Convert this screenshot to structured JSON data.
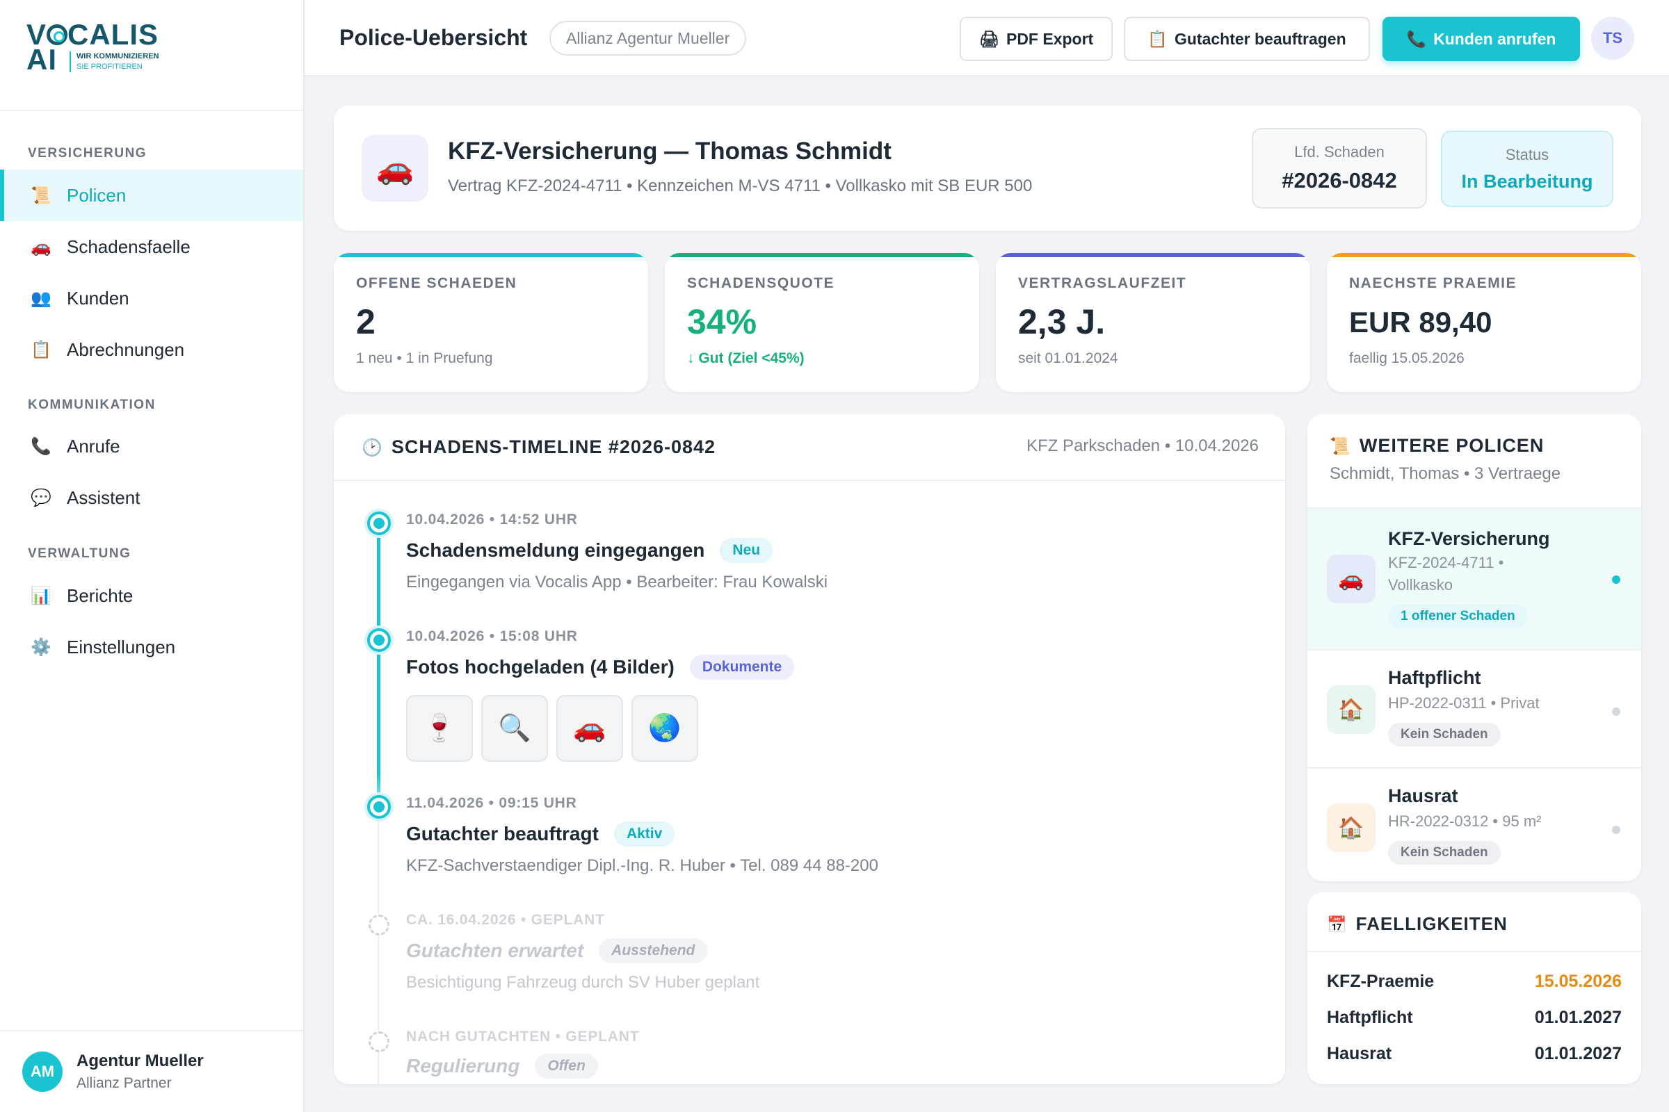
{
  "brand": {
    "logo_top": "VOCALIS",
    "logo_bottom": "AI",
    "tagline_1": "WIR KOMMUNIZIEREN",
    "tagline_2": "SIE PROFITIEREN"
  },
  "sidebar": {
    "sections": [
      "VERSICHERUNG",
      "KOMMUNIKATION",
      "VERWALTUNG"
    ],
    "items": [
      {
        "label": "Policen",
        "icon": "scroll-icon",
        "glyph": "📜",
        "active": true
      },
      {
        "label": "Schadensfaelle",
        "icon": "car-icon",
        "glyph": "🚗"
      },
      {
        "label": "Kunden",
        "icon": "users-icon",
        "glyph": "👥"
      },
      {
        "label": "Abrechnungen",
        "icon": "clipboard-icon",
        "glyph": "📋"
      },
      {
        "label": "Anrufe",
        "icon": "phone-icon",
        "glyph": "📞"
      },
      {
        "label": "Assistent",
        "icon": "chat-bubble-icon",
        "glyph": "💬"
      },
      {
        "label": "Berichte",
        "icon": "bar-chart-icon",
        "glyph": "📊"
      },
      {
        "label": "Einstellungen",
        "icon": "gear-icon",
        "glyph": "⚙️"
      }
    ],
    "agent": {
      "initials": "AM",
      "name": "Agentur Mueller",
      "role": "Allianz Partner"
    }
  },
  "topbar": {
    "title": "Police-Uebersicht",
    "agency_tag": "Allianz Agentur Mueller",
    "pdf_export": "PDF Export",
    "pdf_glyph": "🖨",
    "expert": "Gutachter beauftragen",
    "expert_glyph": "📋",
    "call": "Kunden anrufen",
    "call_glyph": "📞",
    "user_initials": "TS"
  },
  "header": {
    "glyph": "🚗",
    "title": "KFZ-Versicherung — Thomas Schmidt",
    "subtitle": "Vertrag KFZ-2024-4711 • Kennzeichen M-VS 4711 • Vollkasko mit SB EUR 500",
    "claim_label": "Lfd. Schaden",
    "claim_value": "#2026-0842",
    "status_label": "Status",
    "status_value": "In Bearbeitung"
  },
  "stats": [
    {
      "label": "OFFENE SCHAEDEN",
      "value": "2",
      "sub": "1 neu • 1 in Pruefung",
      "color": "#19c3cf"
    },
    {
      "label": "SCHADENSQUOTE",
      "value": "34%",
      "sub": "↓ Gut (Ziel <45%)",
      "color": "#16b07a"
    },
    {
      "label": "VERTRAGSLAUFZEIT",
      "value": "2,3 J.",
      "sub": "seit 01.01.2024",
      "color": "#5b62d6"
    },
    {
      "label": "NAECHSTE PRAEMIE",
      "value": "EUR 89,40",
      "sub": "faellig 15.05.2026",
      "color": "#f29d1c"
    }
  ],
  "timeline": {
    "glyph": "🕑",
    "title": "SCHADENS-TIMELINE #2026-0842",
    "meta": "KFZ Parkschaden • 10.04.2026",
    "events": [
      {
        "time": "10.04.2026 • 14:52 UHR",
        "title": "Schadensmeldung eingegangen",
        "badge": "Neu",
        "desc": "Eingegangen via Vocalis App • Bearbeiter: Frau Kowalski"
      },
      {
        "time": "10.04.2026 • 15:08 UHR",
        "title": "Fotos hochgeladen (4 Bilder)",
        "badge": "Dokumente",
        "desc": ""
      },
      {
        "time": "11.04.2026 • 09:15 UHR",
        "title": "Gutachter beauftragt",
        "badge": "Aktiv",
        "desc": "KFZ-Sachverstaendiger Dipl.-Ing. R. Huber • Tel. 089 44 88-200"
      },
      {
        "time": "CA. 16.04.2026 • GEPLANT",
        "title": "Gutachten erwartet",
        "badge": "Ausstehend",
        "desc": "Besichtigung Fahrzeug durch SV Huber geplant"
      },
      {
        "time": "NACH GUTACHTEN • GEPLANT",
        "title": "Regulierung",
        "badge": "Offen",
        "desc": ""
      }
    ],
    "photos": [
      {
        "icon": "wine-glass-icon",
        "glyph": "🍷"
      },
      {
        "icon": "magnifier-icon",
        "glyph": "🔍"
      },
      {
        "icon": "car-icon",
        "glyph": "🚗"
      },
      {
        "icon": "globe-icon",
        "glyph": "🌏"
      }
    ]
  },
  "policies": {
    "glyph": "📜",
    "title": "WEITERE POLICEN",
    "subtitle": "Schmidt, Thomas • 3 Vertraege",
    "items": [
      {
        "glyph": "🚗",
        "name": "KFZ-Versicherung",
        "meta": "KFZ-2024-4711 • Vollkasko",
        "pill": "1 offener Schaden"
      },
      {
        "glyph": "🏠",
        "name": "Haftpflicht",
        "meta": "HP-2022-0311 • Privat",
        "pill": "Kein Schaden"
      },
      {
        "glyph": "🏠",
        "name": "Hausrat",
        "meta": "HR-2022-0312 • 95 m²",
        "pill": "Kein Schaden"
      }
    ]
  },
  "due": {
    "glyph": "📅",
    "title": "FAELLIGKEITEN",
    "rows": [
      {
        "label": "KFZ-Praemie",
        "date": "15.05.2026",
        "color": "#e88a14"
      },
      {
        "label": "Haftpflicht",
        "date": "01.01.2027"
      },
      {
        "label": "Hausrat",
        "date": "01.01.2027"
      }
    ]
  }
}
